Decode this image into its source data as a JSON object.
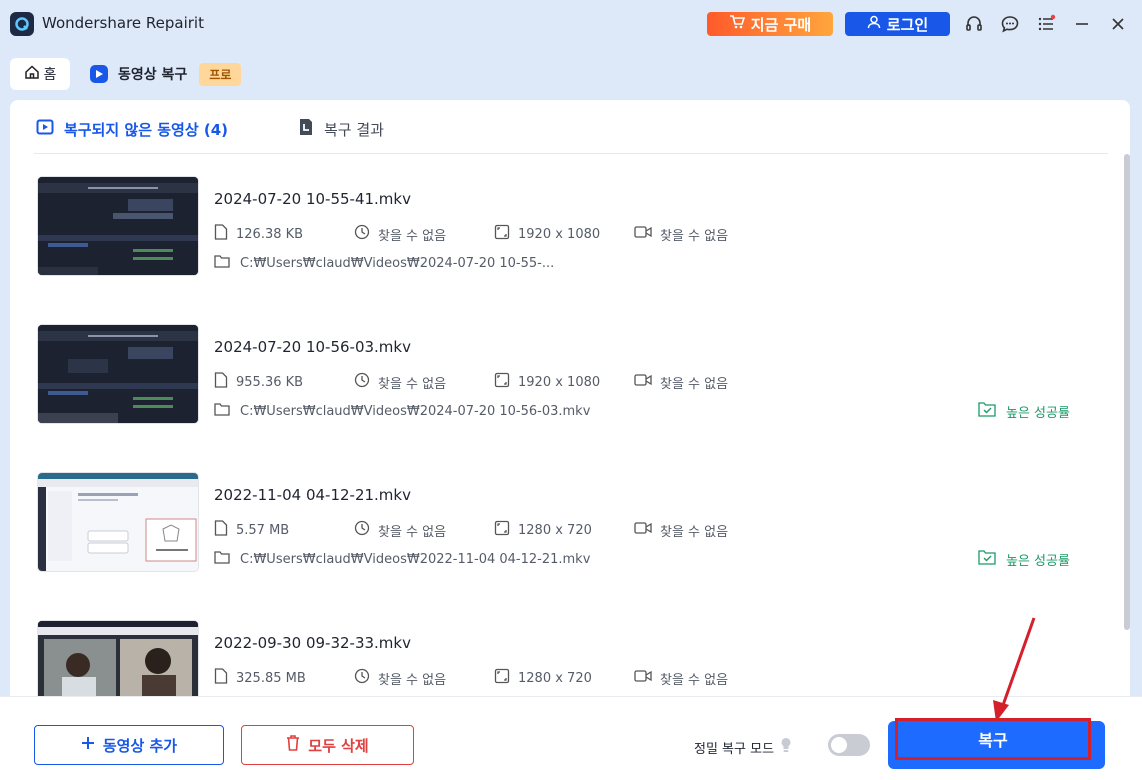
{
  "app": {
    "title": "Wondershare Repairit"
  },
  "header": {
    "buy_label": "지금 구매",
    "login_label": "로그인"
  },
  "nav": {
    "home_label": "홈",
    "section_label": "동영상 복구",
    "pro_badge": "프로"
  },
  "tabs": [
    {
      "label": "복구되지 않은 동영상 (4)",
      "active": true
    },
    {
      "label": "복구 결과",
      "active": false
    }
  ],
  "files": [
    {
      "name": "2024-07-20 10-55-41.mkv",
      "size": "126.38 KB",
      "duration": "찾을 수 없음",
      "resolution": "1920 x 1080",
      "codec": "찾을 수 없음",
      "path": "C:₩Users₩claud₩Videos₩2024-07-20 10-55-...",
      "status": ""
    },
    {
      "name": "2024-07-20 10-56-03.mkv",
      "size": "955.36 KB",
      "duration": "찾을 수 없음",
      "resolution": "1920 x 1080",
      "codec": "찾을 수 없음",
      "path": "C:₩Users₩claud₩Videos₩2024-07-20 10-56-03.mkv",
      "status": "높은 성공률"
    },
    {
      "name": "2022-11-04 04-12-21.mkv",
      "size": "5.57 MB",
      "duration": "찾을 수 없음",
      "resolution": "1280 x 720",
      "codec": "찾을 수 없음",
      "path": "C:₩Users₩claud₩Videos₩2022-11-04 04-12-21.mkv",
      "status": "높은 성공률"
    },
    {
      "name": "2022-09-30 09-32-33.mkv",
      "size": "325.85 MB",
      "duration": "찾을 수 없음",
      "resolution": "1280 x 720",
      "codec": "찾을 수 없음",
      "path": "",
      "status": ""
    }
  ],
  "bottom": {
    "add_label": "동영상 추가",
    "delete_label": "모두 삭제",
    "mode_label": "정밀 복구 모드",
    "mode_enabled": false,
    "repair_label": "복구"
  },
  "colors": {
    "accent": "#1857e8",
    "success": "#1a9a66",
    "danger": "#e04040",
    "annotation": "#d4202a"
  }
}
